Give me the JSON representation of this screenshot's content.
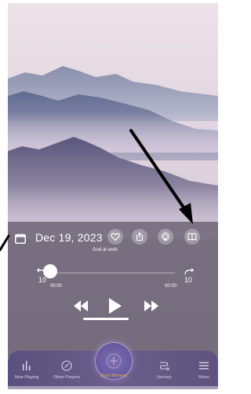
{
  "header": {
    "date": "Dec 19, 2023",
    "subtitle": "God at work"
  },
  "actions": {
    "icons": [
      "heart-icon",
      "share-icon",
      "airplay-icon",
      "book-icon"
    ]
  },
  "player": {
    "skip_back_seconds": "10",
    "skip_forward_seconds": "10",
    "elapsed": "00:00",
    "remaining": "00:00",
    "progress": 0
  },
  "nav": {
    "items": [
      {
        "label": "Now Playing",
        "icon": "bars-icon"
      },
      {
        "label": "Other Prayers",
        "icon": "compass-icon"
      },
      {
        "label": "Daily Moment",
        "icon": "moment-icon"
      },
      {
        "label": "Journey",
        "icon": "path-icon"
      },
      {
        "label": "Menu",
        "icon": "menu-icon"
      }
    ],
    "active_color": "#e2b23d"
  },
  "colors": {
    "panel": "#6a6070",
    "nav_bg": "#5f527f",
    "accent": "#e2b23d"
  }
}
